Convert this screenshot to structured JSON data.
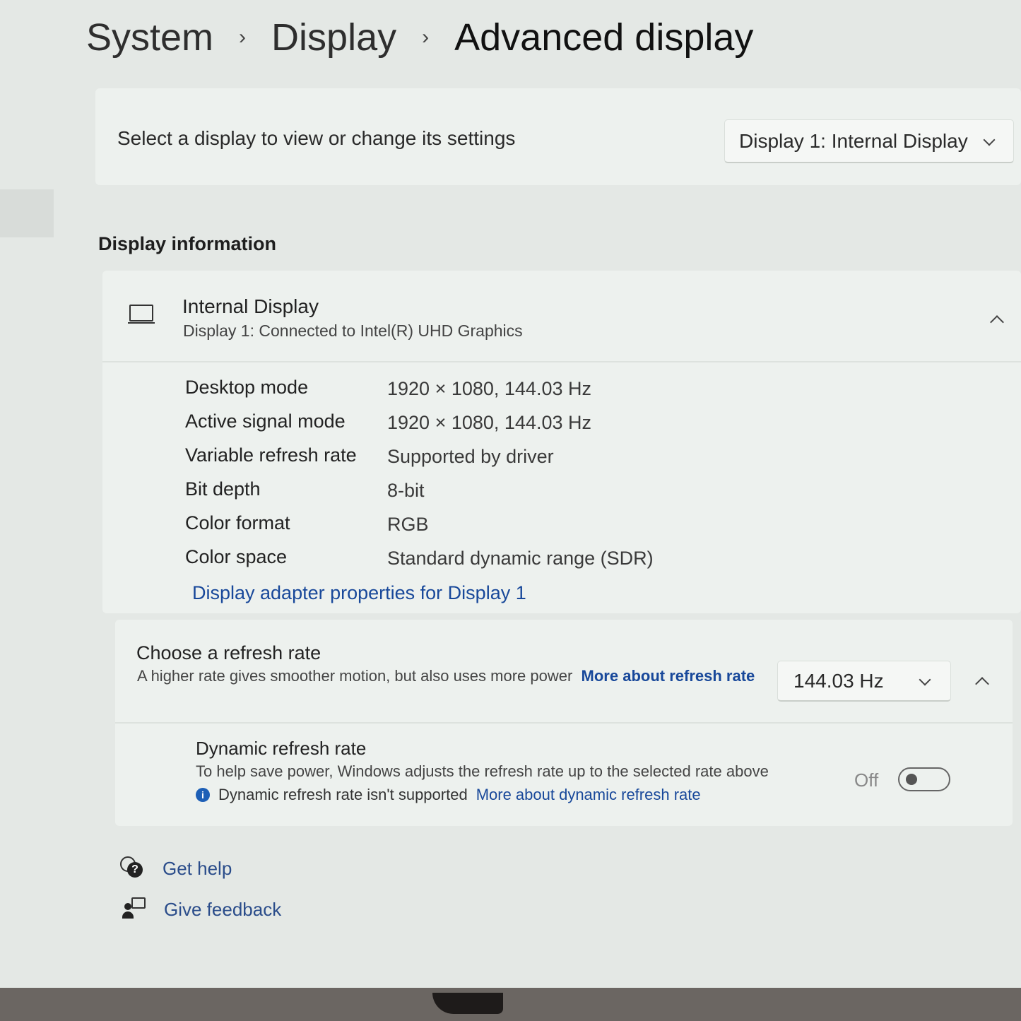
{
  "breadcrumb": {
    "items": [
      "System",
      "Display"
    ],
    "current": "Advanced display"
  },
  "display_selector": {
    "label": "Select a display to view or change its settings",
    "selected": "Display 1: Internal Display"
  },
  "display_information": {
    "section_title": "Display information",
    "display_name": "Internal Display",
    "display_subtitle": "Display 1: Connected to Intel(R) UHD Graphics",
    "properties": [
      {
        "label": "Desktop mode",
        "value": "1920 × 1080, 144.03 Hz"
      },
      {
        "label": "Active signal mode",
        "value": "1920 × 1080, 144.03 Hz"
      },
      {
        "label": "Variable refresh rate",
        "value": "Supported by driver"
      },
      {
        "label": "Bit depth",
        "value": "8-bit"
      },
      {
        "label": "Color format",
        "value": "RGB"
      },
      {
        "label": "Color space",
        "value": "Standard dynamic range (SDR)"
      }
    ],
    "adapter_link": "Display adapter properties for Display 1"
  },
  "refresh_rate": {
    "title": "Choose a refresh rate",
    "description": "A higher rate gives smoother motion, but also uses more power",
    "link": "More about refresh rate",
    "selected": "144.03 Hz"
  },
  "dynamic_refresh": {
    "title": "Dynamic refresh rate",
    "description": "To help save power, Windows adjusts the refresh rate up to the selected rate above",
    "note": "Dynamic refresh rate isn't supported",
    "link": "More about dynamic refresh rate",
    "toggle_state": "Off"
  },
  "footer": {
    "get_help": "Get help",
    "give_feedback": "Give feedback"
  },
  "colors": {
    "background": "#e4e8e5",
    "card": "#edf1ee",
    "link": "#18489a",
    "info_dot": "#1d5fb6"
  }
}
